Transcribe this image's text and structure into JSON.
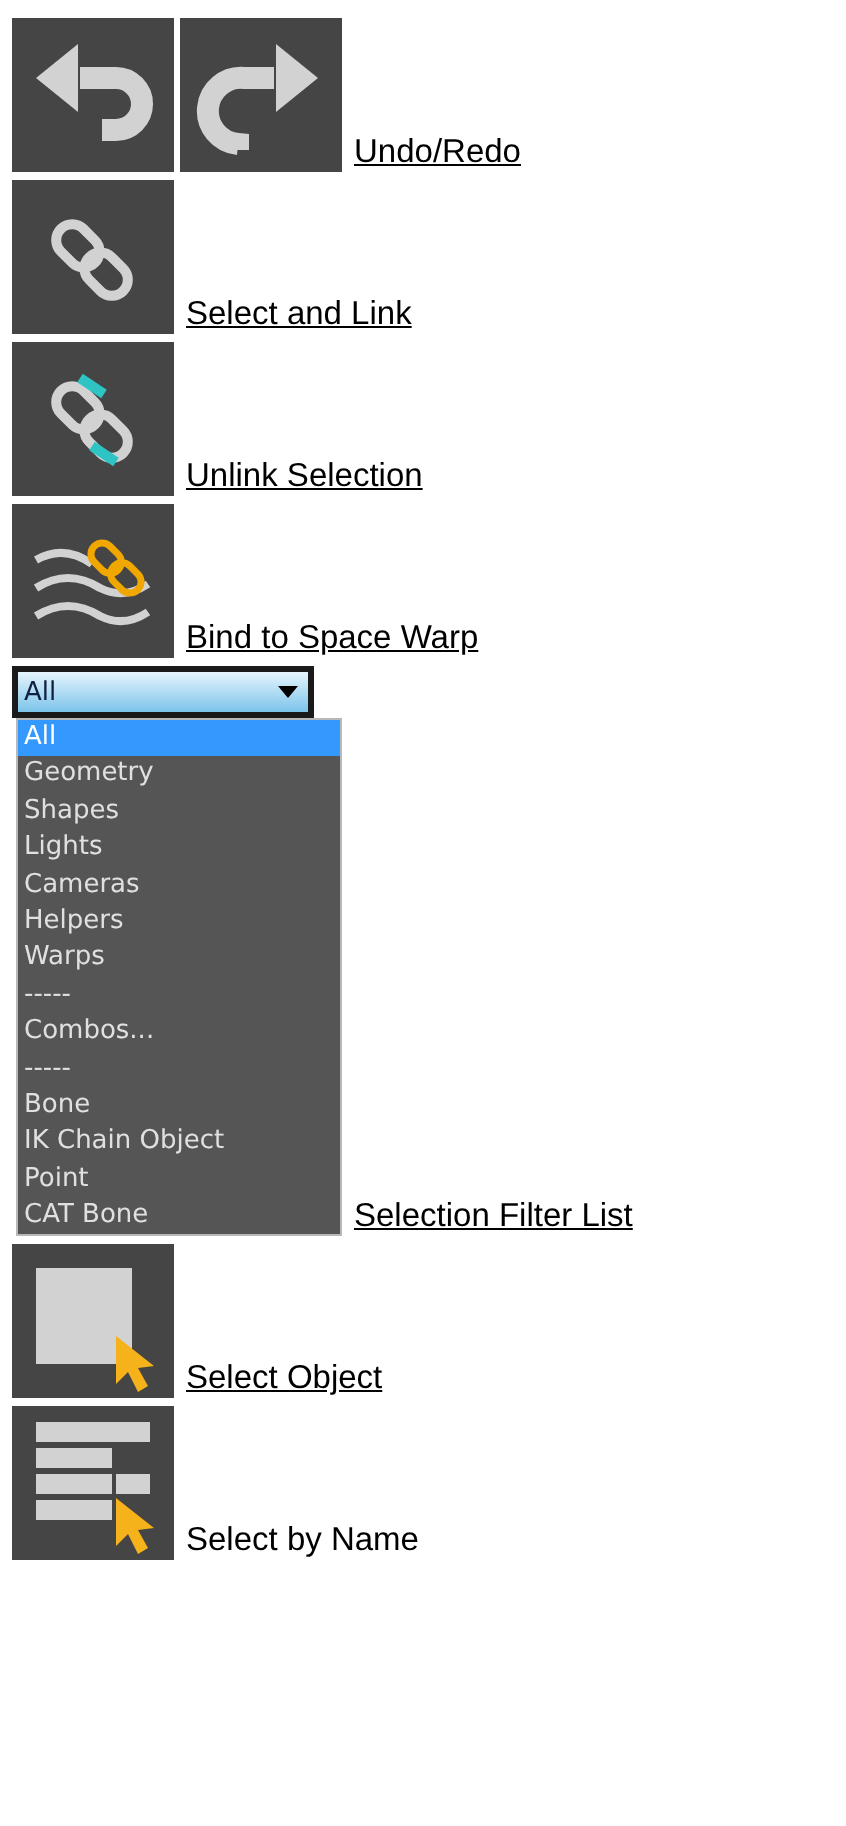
{
  "entries": [
    {
      "kind": "icons",
      "label": "Undo/Redo",
      "link": true
    },
    {
      "kind": "icons",
      "label": "Select and Link",
      "link": true
    },
    {
      "kind": "icons",
      "label": "Unlink Selection",
      "link": true
    },
    {
      "kind": "icons",
      "label": "Bind to Space Warp",
      "link": true
    },
    {
      "kind": "dropdown",
      "label": "Selection Filter List",
      "link": true,
      "value": "All",
      "options": [
        {
          "label": "All",
          "selected": true
        },
        {
          "label": "Geometry",
          "selected": false
        },
        {
          "label": "Shapes",
          "selected": false
        },
        {
          "label": "Lights",
          "selected": false
        },
        {
          "label": "Cameras",
          "selected": false
        },
        {
          "label": "Helpers",
          "selected": false
        },
        {
          "label": "Warps",
          "selected": false
        },
        {
          "label": "-----",
          "selected": false
        },
        {
          "label": "Combos...",
          "selected": false
        },
        {
          "label": "-----",
          "selected": false
        },
        {
          "label": "Bone",
          "selected": false
        },
        {
          "label": "IK Chain Object",
          "selected": false
        },
        {
          "label": "Point",
          "selected": false
        },
        {
          "label": "CAT Bone",
          "selected": false
        }
      ]
    },
    {
      "kind": "icons",
      "label": "Select Object",
      "link": true
    },
    {
      "kind": "icons",
      "label": "Select by Name",
      "link": false
    }
  ]
}
